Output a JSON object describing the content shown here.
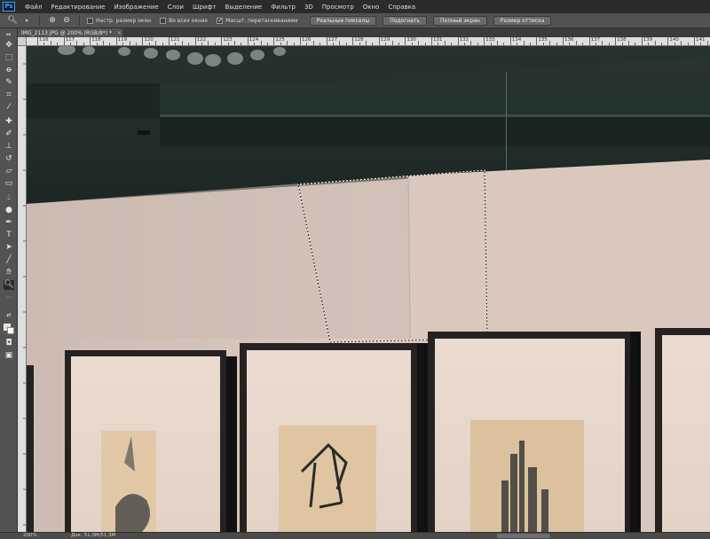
{
  "app": {
    "logo": "Ps"
  },
  "menu": [
    "Файл",
    "Редактирование",
    "Изображение",
    "Слои",
    "Шрифт",
    "Выделение",
    "Фильтр",
    "3D",
    "Просмотр",
    "Окно",
    "Справка"
  ],
  "options": {
    "tool_icon": "zoom-icon",
    "checkbox_resize": "Настр. размер окон",
    "checkbox_all_windows": "Во всех окнах",
    "checkbox_scrubby": "Масшт. перетаскиванием",
    "btn_actual": "Реальные пикселы",
    "btn_fit": "Подогнать",
    "btn_fill": "Полный экран",
    "btn_print": "Размер оттиска"
  },
  "document": {
    "tab_title": "IMG_2113.JPG @ 200% (RGB/8*) *",
    "close_glyph": "×"
  },
  "ruler": {
    "labels": [
      "116",
      "117",
      "118",
      "119",
      "120",
      "121",
      "122",
      "123",
      "124",
      "125",
      "126",
      "127",
      "128",
      "129",
      "130",
      "131",
      "132",
      "133",
      "134",
      "135",
      "136",
      "137",
      "138",
      "139",
      "140",
      "141"
    ]
  },
  "status": {
    "zoom": "200%",
    "doc": "Док: 51,3M/51,3M"
  },
  "colors": {
    "foreground": "#f6d9c2",
    "background": "#ffffff",
    "ui_dark": "#2b2b2b",
    "ui_panel": "#535353"
  },
  "canvas_image": {
    "description_icon": "photo-canvas"
  }
}
